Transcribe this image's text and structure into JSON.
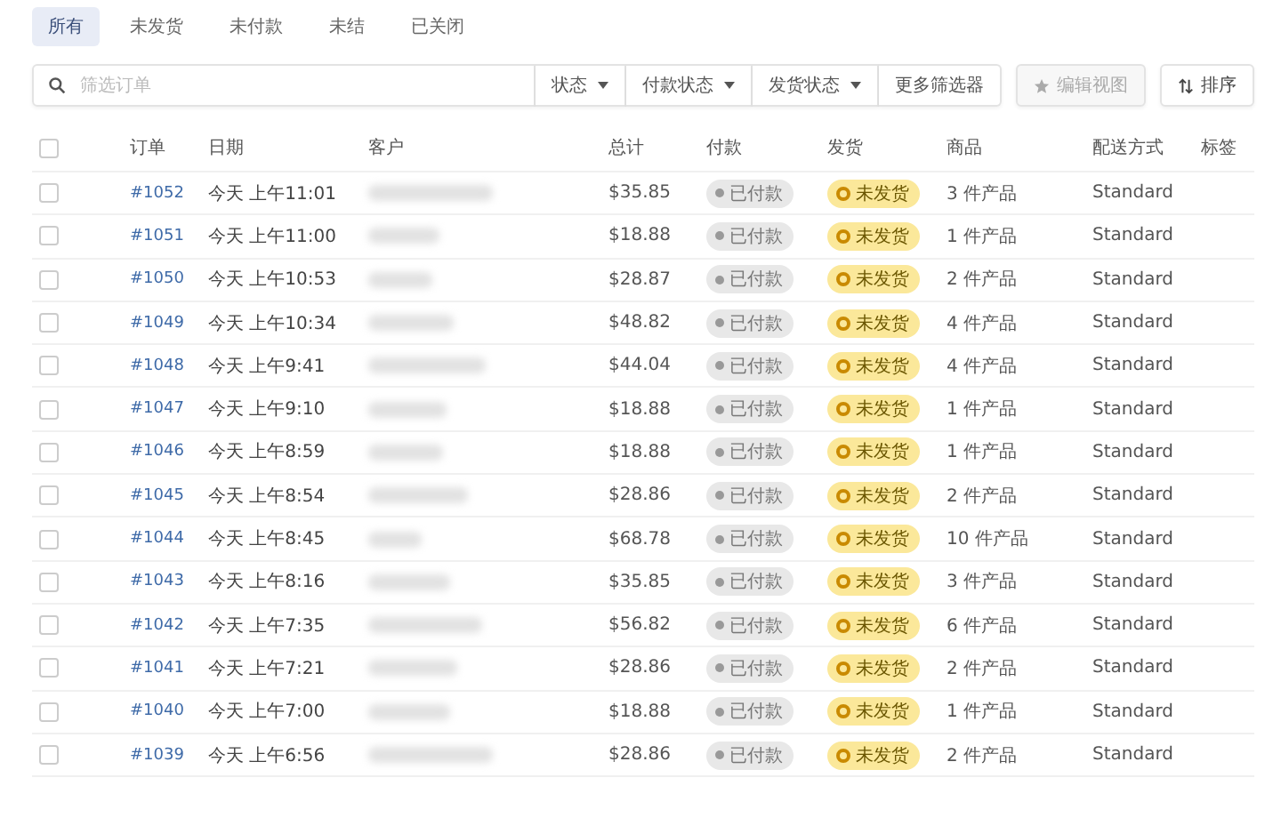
{
  "tabs": [
    {
      "label": "所有",
      "selected": true
    },
    {
      "label": "未发货",
      "selected": false
    },
    {
      "label": "未付款",
      "selected": false
    },
    {
      "label": "未结",
      "selected": false
    },
    {
      "label": "已关闭",
      "selected": false
    }
  ],
  "search": {
    "placeholder": "筛选订单"
  },
  "filters": [
    {
      "label": "状态",
      "dropdown": true
    },
    {
      "label": "付款状态",
      "dropdown": true
    },
    {
      "label": "发货状态",
      "dropdown": true
    },
    {
      "label": "更多筛选器",
      "dropdown": false
    }
  ],
  "edit_view": {
    "label": "编辑视图",
    "disabled": true
  },
  "sort": {
    "label": "排序"
  },
  "table": {
    "header_checked": false,
    "columns": [
      "订单",
      "日期",
      "客户",
      "总计",
      "付款",
      "发货",
      "商品",
      "配送方式",
      "标签"
    ],
    "rows": [
      {
        "checked": false,
        "order": "#1052",
        "date": "今天 上午11:01",
        "total": "$35.85",
        "payment": "已付款",
        "fulfillment": "未发货",
        "items": "3 件产品",
        "delivery": "Standard"
      },
      {
        "checked": false,
        "order": "#1051",
        "date": "今天 上午11:00",
        "total": "$18.88",
        "payment": "已付款",
        "fulfillment": "未发货",
        "items": "1 件产品",
        "delivery": "Standard"
      },
      {
        "checked": false,
        "order": "#1050",
        "date": "今天 上午10:53",
        "total": "$28.87",
        "payment": "已付款",
        "fulfillment": "未发货",
        "items": "2 件产品",
        "delivery": "Standard"
      },
      {
        "checked": false,
        "order": "#1049",
        "date": "今天 上午10:34",
        "total": "$48.82",
        "payment": "已付款",
        "fulfillment": "未发货",
        "items": "4 件产品",
        "delivery": "Standard"
      },
      {
        "checked": false,
        "order": "#1048",
        "date": "今天 上午9:41",
        "total": "$44.04",
        "payment": "已付款",
        "fulfillment": "未发货",
        "items": "4 件产品",
        "delivery": "Standard"
      },
      {
        "checked": false,
        "order": "#1047",
        "date": "今天 上午9:10",
        "total": "$18.88",
        "payment": "已付款",
        "fulfillment": "未发货",
        "items": "1 件产品",
        "delivery": "Standard"
      },
      {
        "checked": false,
        "order": "#1046",
        "date": "今天 上午8:59",
        "total": "$18.88",
        "payment": "已付款",
        "fulfillment": "未发货",
        "items": "1 件产品",
        "delivery": "Standard"
      },
      {
        "checked": false,
        "order": "#1045",
        "date": "今天 上午8:54",
        "total": "$28.86",
        "payment": "已付款",
        "fulfillment": "未发货",
        "items": "2 件产品",
        "delivery": "Standard"
      },
      {
        "checked": false,
        "order": "#1044",
        "date": "今天 上午8:45",
        "total": "$68.78",
        "payment": "已付款",
        "fulfillment": "未发货",
        "items": "10 件产品",
        "delivery": "Standard"
      },
      {
        "checked": false,
        "order": "#1043",
        "date": "今天 上午8:16",
        "total": "$35.85",
        "payment": "已付款",
        "fulfillment": "未发货",
        "items": "3 件产品",
        "delivery": "Standard"
      },
      {
        "checked": false,
        "order": "#1042",
        "date": "今天 上午7:35",
        "total": "$56.82",
        "payment": "已付款",
        "fulfillment": "未发货",
        "items": "6 件产品",
        "delivery": "Standard"
      },
      {
        "checked": false,
        "order": "#1041",
        "date": "今天 上午7:21",
        "total": "$28.86",
        "payment": "已付款",
        "fulfillment": "未发货",
        "items": "2 件产品",
        "delivery": "Standard"
      },
      {
        "checked": false,
        "order": "#1040",
        "date": "今天 上午7:00",
        "total": "$18.88",
        "payment": "已付款",
        "fulfillment": "未发货",
        "items": "1 件产品",
        "delivery": "Standard"
      },
      {
        "checked": false,
        "order": "#1039",
        "date": "今天 上午6:56",
        "total": "$28.86",
        "payment": "已付款",
        "fulfillment": "未发货",
        "items": "2 件产品",
        "delivery": "Standard"
      }
    ]
  }
}
